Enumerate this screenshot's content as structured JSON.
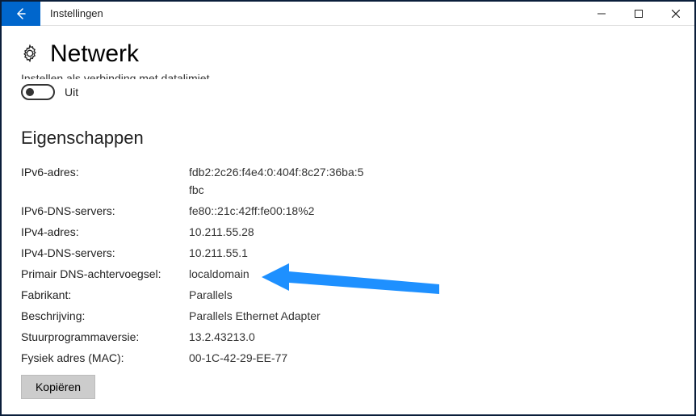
{
  "window": {
    "title": "Instellingen"
  },
  "page": {
    "title": "Netwerk"
  },
  "metered": {
    "label": "Instellen als verbinding met datalimiet",
    "state_label": "Uit"
  },
  "section": {
    "title": "Eigenschappen"
  },
  "properties": [
    {
      "label": "IPv6-adres:",
      "value": "fdb2:2c26:f4e4:0:404f:8c27:36ba:5fbc"
    },
    {
      "label": "IPv6-DNS-servers:",
      "value": "fe80::21c:42ff:fe00:18%2"
    },
    {
      "label": "IPv4-adres:",
      "value": "10.211.55.28"
    },
    {
      "label": "IPv4-DNS-servers:",
      "value": "10.211.55.1"
    },
    {
      "label": "Primair DNS-achtervoegsel:",
      "value": "localdomain"
    },
    {
      "label": "Fabrikant:",
      "value": "Parallels"
    },
    {
      "label": "Beschrijving:",
      "value": "Parallels Ethernet Adapter"
    },
    {
      "label": "Stuurprogrammaversie:",
      "value": "13.2.43213.0"
    },
    {
      "label": "Fysiek adres (MAC):",
      "value": "00-1C-42-29-EE-77"
    }
  ],
  "copy": {
    "label": "Kopiëren"
  },
  "colors": {
    "accent": "#0066cc",
    "arrow": "#1e90ff"
  }
}
